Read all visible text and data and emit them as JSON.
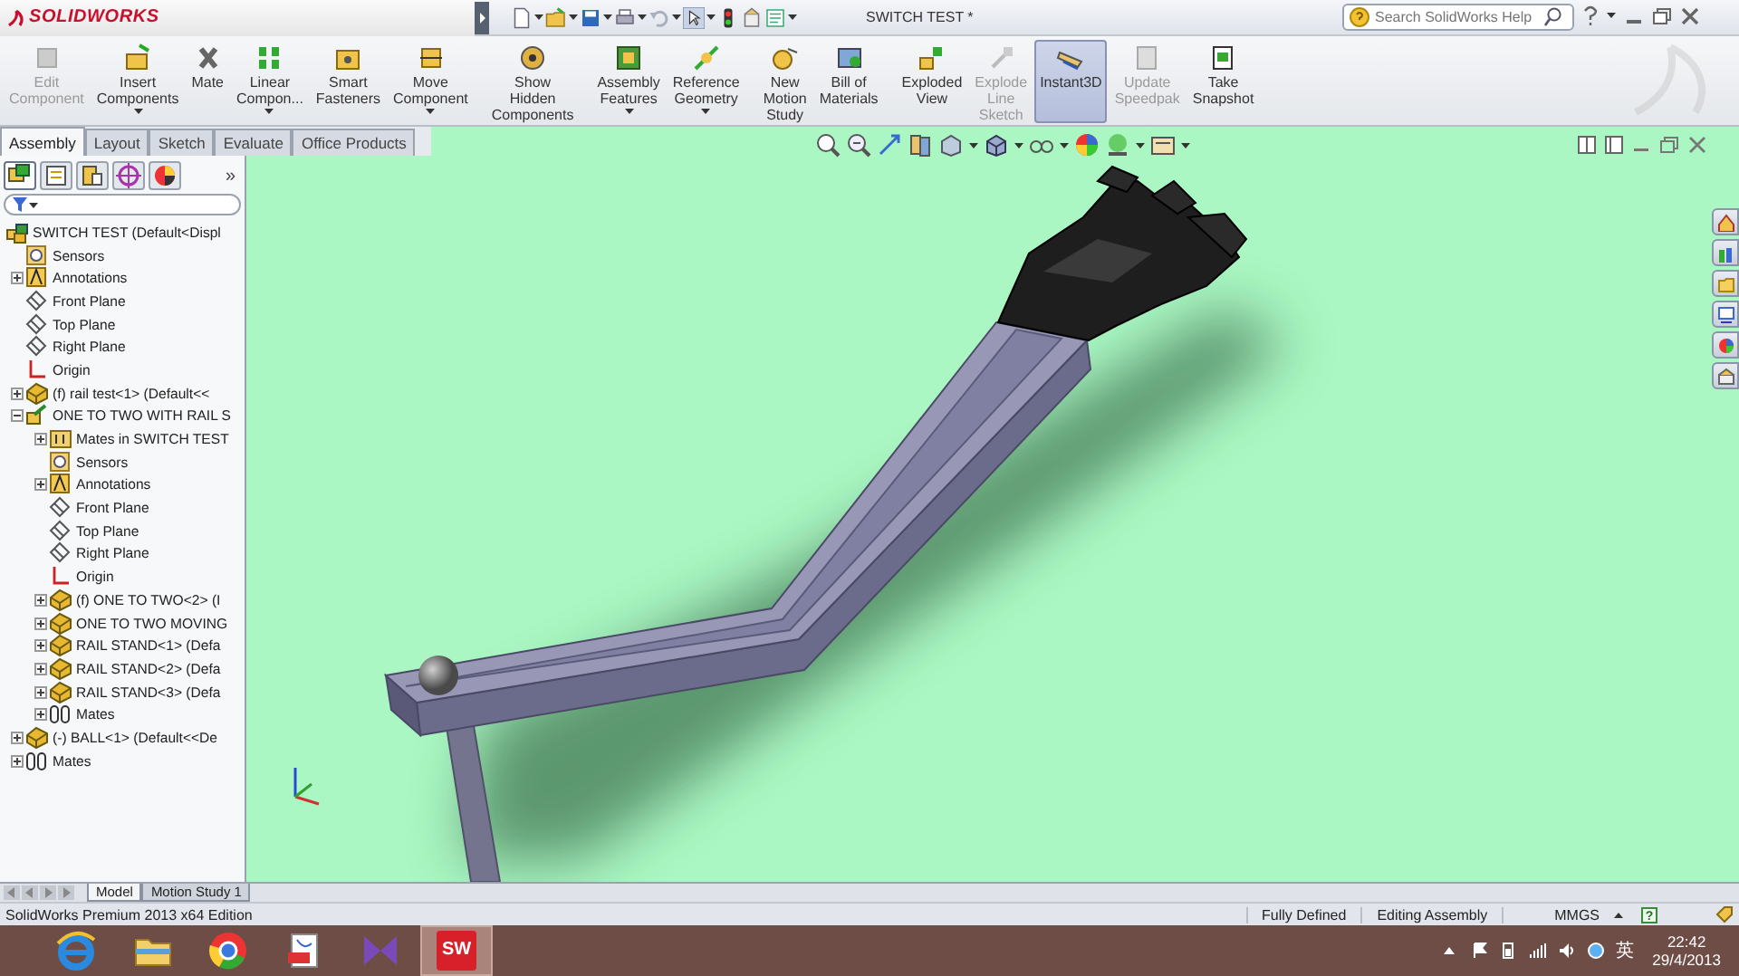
{
  "title_bar": {
    "logo": "SOLIDWORKS",
    "document_title": "SWITCH TEST *",
    "search": {
      "placeholder": "Search SolidWorks Help"
    }
  },
  "ribbon": {
    "buttons": [
      {
        "label": "Edit\nComponent",
        "kind": "edit",
        "disabled": true,
        "selected": false,
        "dropdown": false
      },
      {
        "label": "Insert\nComponents",
        "kind": "insert",
        "disabled": false,
        "selected": false,
        "dropdown": true
      },
      {
        "label": "Mate",
        "kind": "mate",
        "disabled": false,
        "selected": false,
        "dropdown": false
      },
      {
        "label": "Linear\nCompon...",
        "kind": "pattern",
        "disabled": false,
        "selected": false,
        "dropdown": true
      },
      {
        "label": "Smart\nFasteners",
        "kind": "fastener",
        "disabled": false,
        "selected": false,
        "dropdown": false
      },
      {
        "label": "Move\nComponent",
        "kind": "move",
        "disabled": false,
        "selected": false,
        "dropdown": true
      },
      {
        "label": "Show\nHidden\nComponents",
        "kind": "show",
        "disabled": false,
        "selected": false,
        "dropdown": false
      },
      {
        "label": "Assembly\nFeatures",
        "kind": "feature",
        "disabled": false,
        "selected": false,
        "dropdown": true
      },
      {
        "label": "Reference\nGeometry",
        "kind": "geometry",
        "disabled": false,
        "selected": false,
        "dropdown": true
      },
      {
        "label": "New\nMotion\nStudy",
        "kind": "motion",
        "disabled": false,
        "selected": false,
        "dropdown": false
      },
      {
        "label": "Bill of\nMaterials",
        "kind": "bom",
        "disabled": false,
        "selected": false,
        "dropdown": false
      },
      {
        "label": "Exploded\nView",
        "kind": "explode",
        "disabled": false,
        "selected": false,
        "dropdown": false
      },
      {
        "label": "Explode\nLine\nSketch",
        "kind": "sketch",
        "disabled": true,
        "selected": false,
        "dropdown": false
      },
      {
        "label": "Instant3D",
        "kind": "instant",
        "disabled": false,
        "selected": true,
        "dropdown": false
      },
      {
        "label": "Update\nSpeedpak",
        "kind": "speedpak",
        "disabled": true,
        "selected": false,
        "dropdown": false
      },
      {
        "label": "Take\nSnapshot",
        "kind": "snapshot",
        "disabled": false,
        "selected": false,
        "dropdown": false
      }
    ]
  },
  "command_tabs": [
    {
      "label": "Assembly",
      "selected": true
    },
    {
      "label": "Layout",
      "selected": false
    },
    {
      "label": "Sketch",
      "selected": false
    },
    {
      "label": "Evaluate",
      "selected": false
    },
    {
      "label": "Office Products",
      "selected": false
    }
  ],
  "feature_manager": {
    "panel_tabs": [
      {
        "selected": true
      },
      {
        "selected": false
      },
      {
        "selected": false
      },
      {
        "selected": false
      },
      {
        "selected": false
      }
    ],
    "more": "»",
    "tree": [
      {
        "label": "SWITCH TEST  (Default<Displ",
        "kind": "assembly",
        "children": [
          {
            "label": "Sensors",
            "kind": "sensor"
          },
          {
            "label": "Annotations",
            "kind": "annotation",
            "expanded": false
          },
          {
            "label": "Front Plane",
            "kind": "plane"
          },
          {
            "label": "Top Plane",
            "kind": "plane"
          },
          {
            "label": "Right Plane",
            "kind": "plane"
          },
          {
            "label": "Origin",
            "kind": "origin"
          },
          {
            "label": "(f) rail test<1> (Default<<",
            "kind": "part",
            "expanded": false
          },
          {
            "label": "ONE TO TWO WITH RAIL S",
            "kind": "subassembly",
            "expanded": true,
            "children": [
              {
                "label": "Mates in SWITCH TEST",
                "kind": "matesfolder",
                "expanded": false
              },
              {
                "label": "Sensors",
                "kind": "sensor"
              },
              {
                "label": "Annotations",
                "kind": "annotation",
                "expanded": false
              },
              {
                "label": "Front Plane",
                "kind": "plane"
              },
              {
                "label": "Top Plane",
                "kind": "plane"
              },
              {
                "label": "Right Plane",
                "kind": "plane"
              },
              {
                "label": "Origin",
                "kind": "origin"
              },
              {
                "label": "(f) ONE TO TWO<2> (I",
                "kind": "part",
                "expanded": false
              },
              {
                "label": "ONE TO TWO MOVING",
                "kind": "part",
                "expanded": false
              },
              {
                "label": "RAIL STAND<1> (Defa",
                "kind": "part",
                "expanded": false
              },
              {
                "label": "RAIL STAND<2> (Defa",
                "kind": "part",
                "expanded": false
              },
              {
                "label": "RAIL STAND<3> (Defa",
                "kind": "part",
                "expanded": false
              },
              {
                "label": "Mates",
                "kind": "mates",
                "expanded": false
              }
            ]
          },
          {
            "label": "(-) BALL<1> (Default<<De",
            "kind": "part",
            "expanded": false
          },
          {
            "label": "Mates",
            "kind": "mates",
            "expanded": false
          }
        ]
      }
    ]
  },
  "bottom_tabs": [
    {
      "label": "Model",
      "selected": true
    },
    {
      "label": "Motion Study 1",
      "selected": false
    }
  ],
  "status_bar": {
    "edition": "SolidWorks Premium 2013 x64 Edition",
    "state": "Fully Defined",
    "mode": "Editing Assembly",
    "units": "MMGS",
    "help": "?"
  },
  "taskbar": {
    "apps": [
      {
        "kind": "ie",
        "selected": false
      },
      {
        "kind": "folder",
        "selected": false
      },
      {
        "kind": "chrome",
        "selected": false
      },
      {
        "kind": "pdf",
        "selected": false
      },
      {
        "kind": "studio",
        "selected": false
      },
      {
        "kind": "solidworks",
        "text": "SW",
        "selected": true
      }
    ],
    "ime": "英",
    "time": "22:42",
    "date": "29/4/2013"
  }
}
